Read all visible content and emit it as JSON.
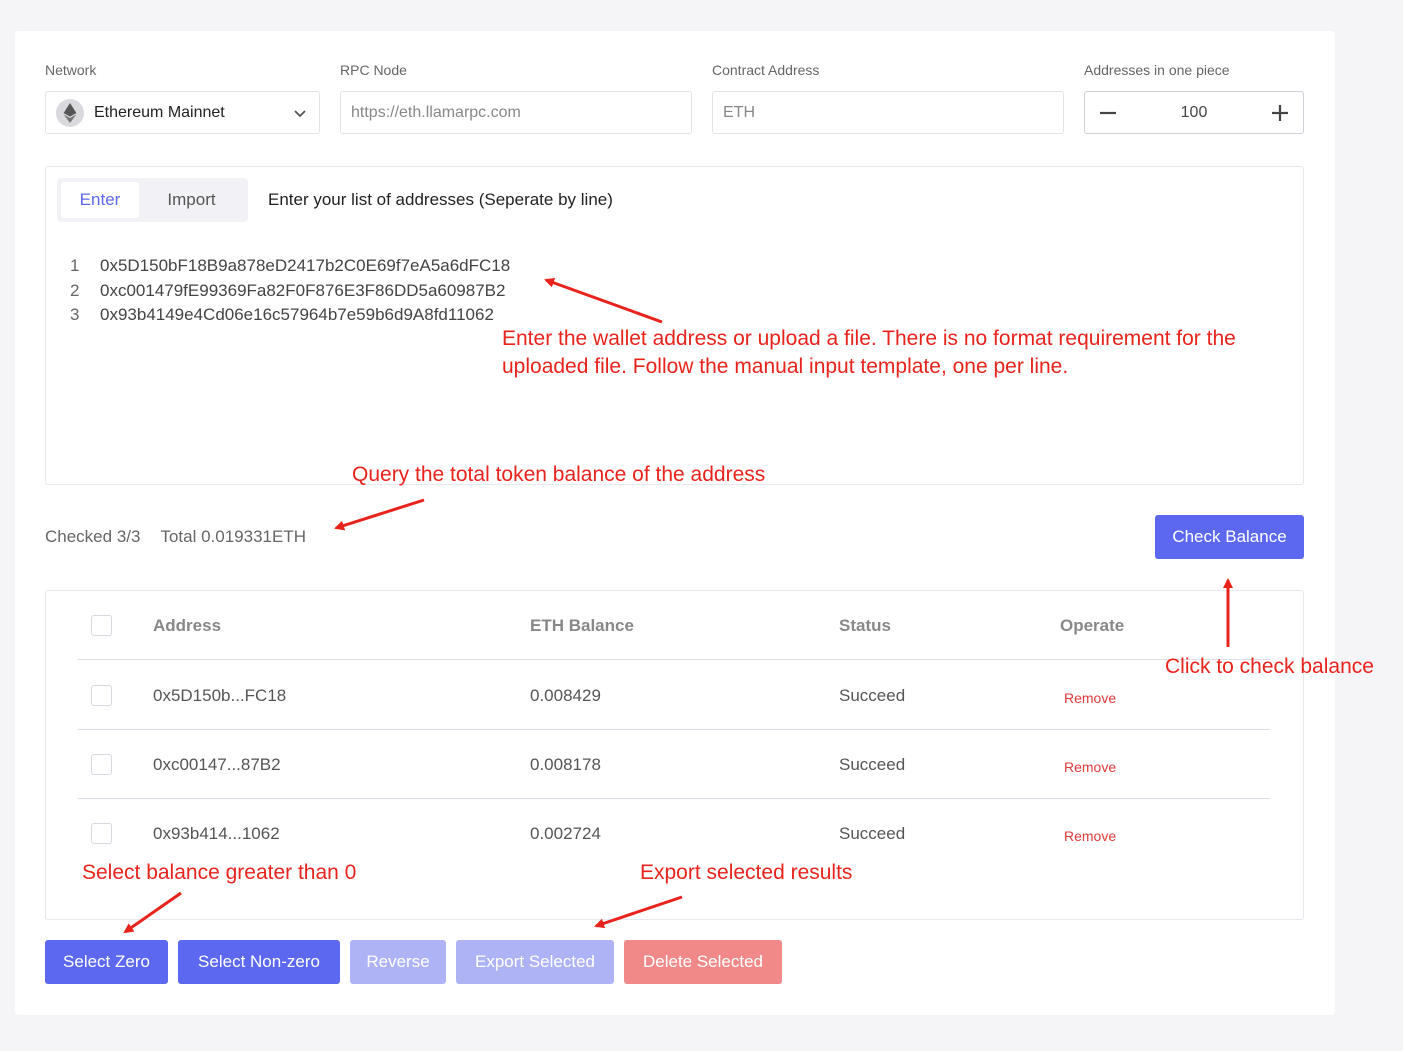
{
  "settings": {
    "network_label": "Network",
    "network_value": "Ethereum Mainnet",
    "rpc_label": "RPC Node",
    "rpc_placeholder": "https://eth.llamarpc.com",
    "contract_label": "Contract Address",
    "contract_placeholder": "ETH",
    "per_piece_label": "Addresses in one piece",
    "per_piece_value": "100",
    "minus": "—",
    "plus": "+"
  },
  "input": {
    "tabs": [
      {
        "label": "Enter",
        "active": true
      },
      {
        "label": "Import",
        "active": false
      }
    ],
    "instruction": "Enter your list of addresses (Seperate by line)",
    "lines": [
      {
        "num": "1",
        "address": "0x5D150bF18B9a878eD2417b2C0E69f7eA5a6dFC18"
      },
      {
        "num": "2",
        "address": "0xc001479fE99369Fa82F0F876E3F86DD5a60987B2"
      },
      {
        "num": "3",
        "address": "0x93b4149e4Cd06e16c57964b7e59b6d9A8fd11062"
      }
    ]
  },
  "summary": {
    "checked": "Checked 3/3",
    "total": "Total 0.019331ETH"
  },
  "check_button": "Check Balance",
  "table": {
    "headers": [
      "Address",
      "ETH Balance",
      "Status",
      "Operate"
    ],
    "rows": [
      {
        "address": "0x5D150b...FC18",
        "balance": "0.008429",
        "status": "Succeed",
        "operate": "Remove"
      },
      {
        "address": "0xc00147...87B2",
        "balance": "0.008178",
        "status": "Succeed",
        "operate": "Remove"
      },
      {
        "address": "0x93b414...1062",
        "balance": "0.002724",
        "status": "Succeed",
        "operate": "Remove"
      }
    ]
  },
  "actions": {
    "select_zero": "Select Zero",
    "select_nonzero": "Select Non-zero",
    "reverse": "Reverse",
    "export_selected": "Export Selected",
    "delete_selected": "Delete Selected"
  },
  "annotations": {
    "upload_note_line1": "Enter the wallet address or upload a file. There is no format requirement for the",
    "upload_note_line2": "uploaded file. Follow the manual input template, one per line.",
    "query_note": "Query the total token balance of the address",
    "click_note": "Click to check balance",
    "select_note": "Select balance greater than 0",
    "export_note": "Export selected results"
  },
  "colors": {
    "primary": "#5c68ef",
    "primary_disabled": "#aeb3f6",
    "danger": "#f18989",
    "annotation": "#e8231c"
  }
}
